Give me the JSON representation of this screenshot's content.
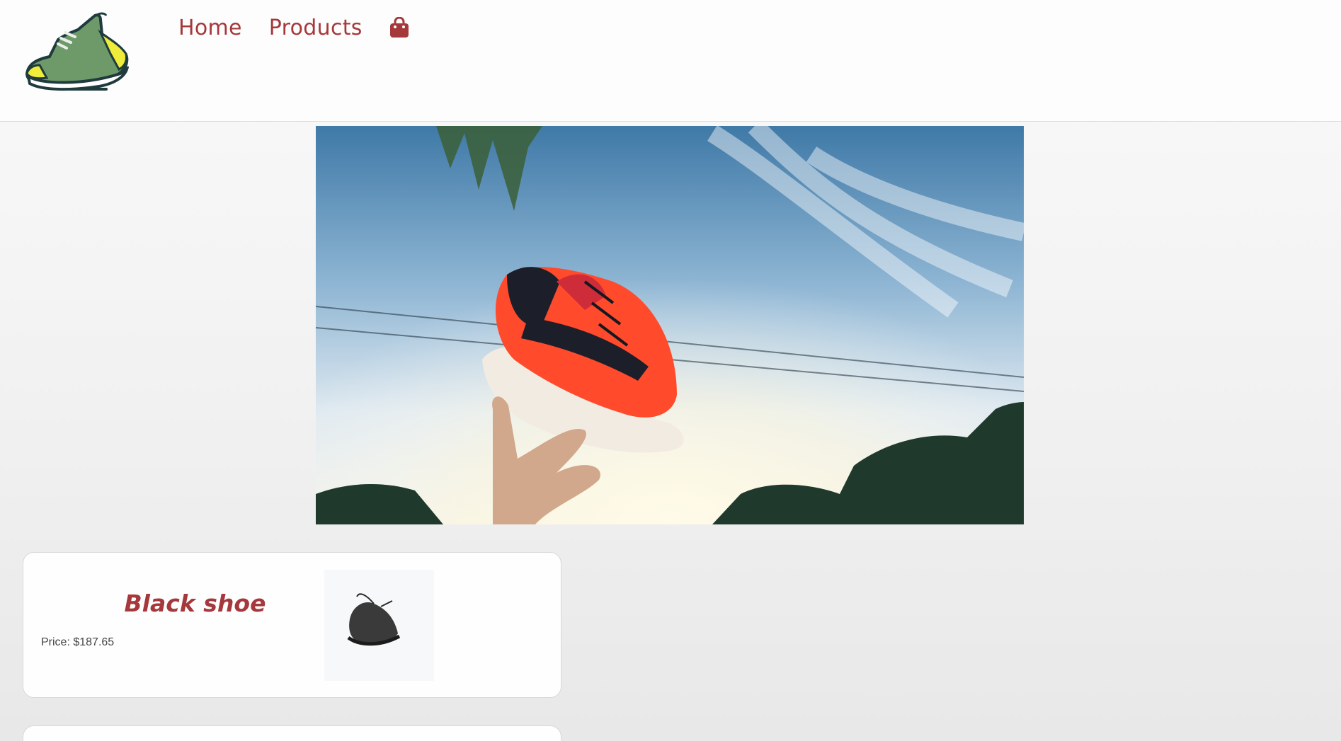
{
  "header": {
    "logo_icon": "sneaker-logo-icon",
    "nav": [
      {
        "label": "Home"
      },
      {
        "label": "Products"
      }
    ],
    "cart_icon": "shopping-bag-icon"
  },
  "hero": {
    "image": "photo: red sneaker tossed into the sky above a hand"
  },
  "products": [
    {
      "title": "Black shoe",
      "price": "Price: $187.65"
    }
  ],
  "colors": {
    "accent": "#a5383b",
    "header_bg": "#fdfdfd"
  }
}
